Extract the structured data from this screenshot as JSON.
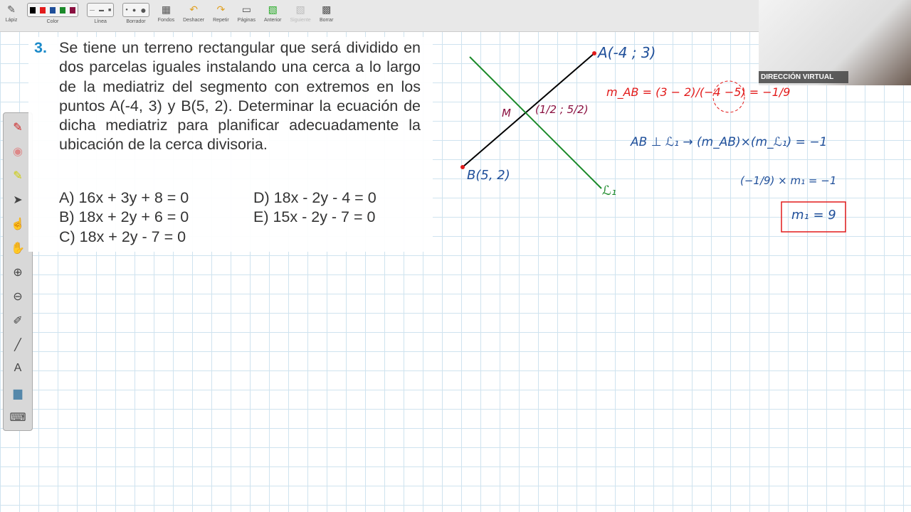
{
  "toolbar": {
    "items": [
      "Lápiz",
      "Color",
      "Línea",
      "Borrador",
      "Fondos",
      "Deshacer",
      "Repetir",
      "Páginas",
      "Anterior",
      "Siguiente",
      "Borrar"
    ],
    "colors": [
      "#000000",
      "#e21b1b",
      "#1f4f9a",
      "#1b8a2a",
      "#8a1040"
    ]
  },
  "problem": {
    "number": "3.",
    "text": "Se tiene un terreno rectangular que será dividido en dos parcelas iguales instalando una cerca a lo largo de la mediatriz del segmento con extremos en los puntos A(-4, 3) y B(5, 2). Determinar la ecuación de dicha mediatriz para planificar adecuadamente la ubicación de la cerca divisoria.",
    "options": [
      "A)  16x + 3y + 8 = 0",
      "B)  18x + 2y + 6 = 0",
      "C)  18x + 2y - 7 = 0",
      "D)  18x - 2y - 4 = 0",
      "E)  15x - 2y - 7 = 0"
    ]
  },
  "camera": {
    "label": "DIRECCIÓN VIRTUAL"
  },
  "handwriting": {
    "a": "A(-4 ; 3)",
    "b": "B(5, 2)",
    "m": "M",
    "mid": "(1/2 ; 5/2)",
    "l1": "ℒ₁",
    "mab": "m_AB = (3 − 2)/(−4 −5) = −1/9",
    "perp": "AB ⊥ ℒ₁ → (m_AB)×(m_ℒ₁) = −1",
    "step": "(−1/9) × m₁ = −1",
    "result": "m₁ = 9"
  }
}
